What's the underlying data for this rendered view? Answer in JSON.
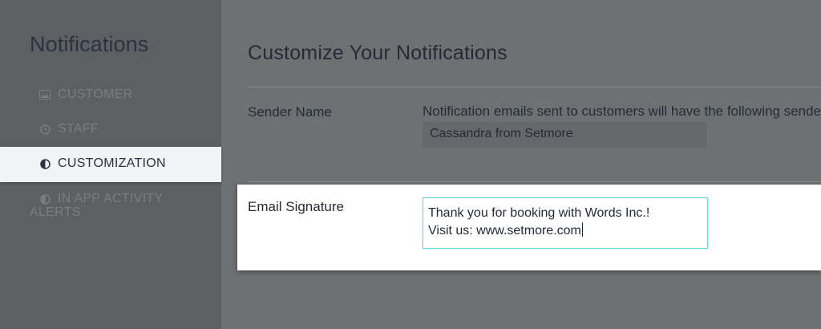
{
  "sidebar": {
    "title": "Notifications",
    "items": [
      {
        "label": "CUSTOMER",
        "icon": "image-icon",
        "active": false
      },
      {
        "label": "STAFF",
        "icon": "clock-icon",
        "active": false
      },
      {
        "label": "CUSTOMIZATION",
        "icon": "contrast-icon",
        "active": true
      },
      {
        "label_line1": "IN APP ACTIVITY",
        "label_line2": "ALERTS",
        "icon": "contrast-icon",
        "active": false
      }
    ]
  },
  "main": {
    "title": "Customize Your Notifications",
    "sender_name": {
      "label": "Sender Name",
      "description": "Notification emails sent to customers will have the following sende",
      "value": "Cassandra from Setmore"
    },
    "email_signature": {
      "label": "Email Signature",
      "line1": "Thank you for booking with Words Inc.!",
      "line2": "Visit us: www.setmore.com"
    }
  },
  "colors": {
    "overlay": "#6f7072",
    "active_nav_bg": "#f1f3f5",
    "focus_border": "#6fd3d9"
  }
}
